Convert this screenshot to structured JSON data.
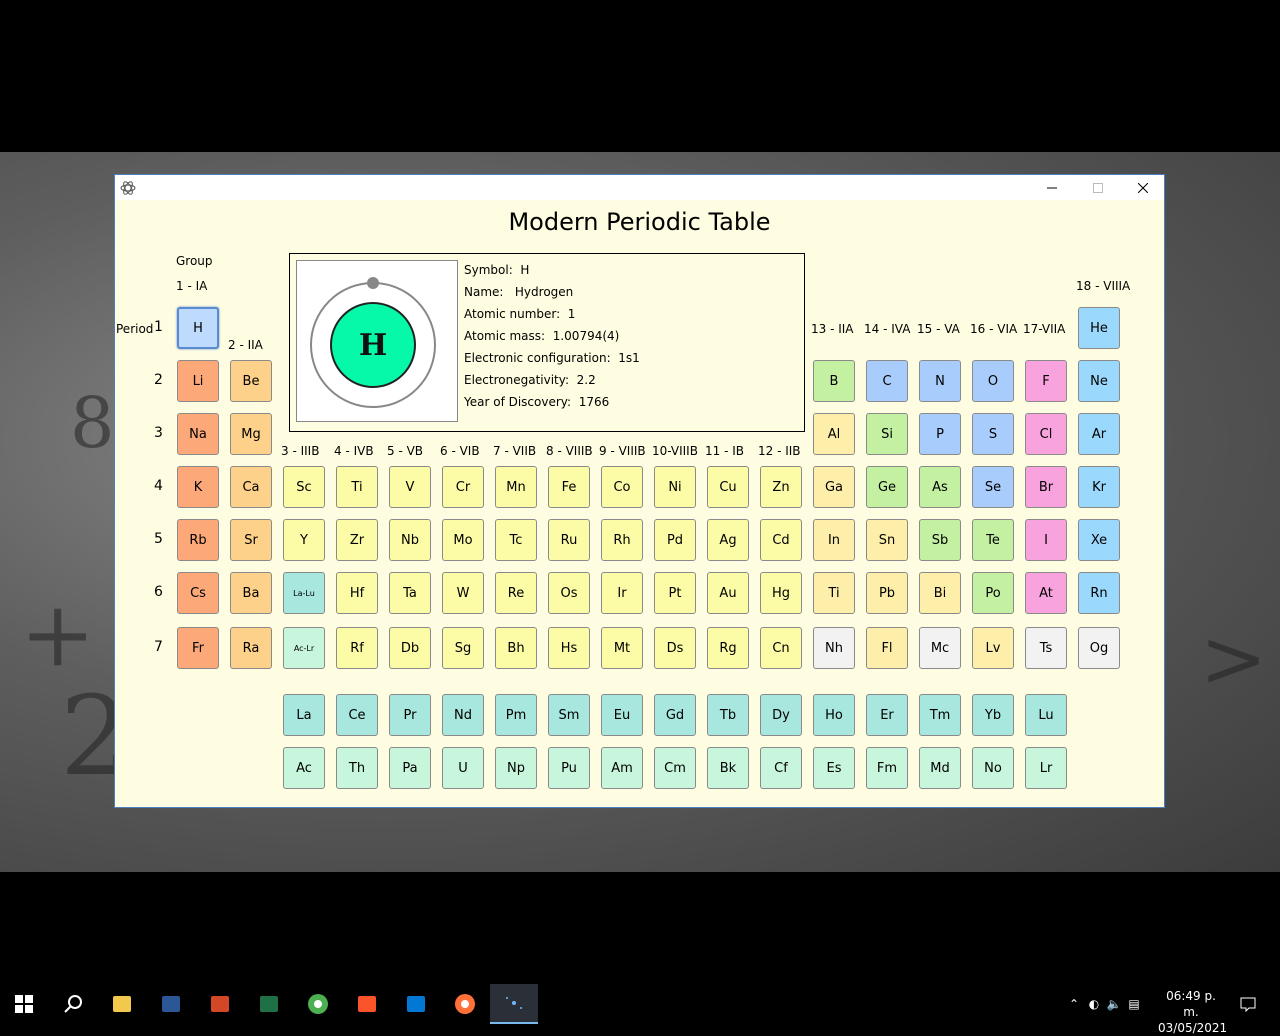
{
  "window": {
    "title": "Modern Periodic Table"
  },
  "labels": {
    "group": "Group",
    "period": "Period",
    "groups": [
      "1 - IA",
      "2 - IIA",
      "3 - IIIB",
      "4 - IVB",
      "5 - VB",
      "6 - VIB",
      "7 - VIIB",
      "8 - VIIIB",
      "9 - VIIIB",
      "10-VIIIB",
      "11 - IB",
      "12 - IIB",
      "13 - IIA",
      "14 - IVA",
      "15 - VA",
      "16 - VIA",
      "17-VIIA",
      "18 - VIIIA"
    ],
    "periods": [
      "1",
      "2",
      "3",
      "4",
      "5",
      "6",
      "7"
    ]
  },
  "selected": {
    "symbol_label": "Symbol:",
    "symbol": "H",
    "name_label": "Name:",
    "name": "Hydrogen",
    "atomic_number_label": "Atomic number:",
    "atomic_number": "1",
    "atomic_mass_label": "Atomic mass:",
    "atomic_mass": "1.00794(4)",
    "config_label": "Electronic configuration:",
    "config": "1s1",
    "electronegativity_label": "Electronegativity:",
    "electronegativity": "2.2",
    "discovery_label": "Year of Discovery:",
    "discovery": "1766",
    "diagram_symbol": "H"
  },
  "colors": {
    "alkali": "#fca878",
    "alkaline": "#fdd18a",
    "transition": "#fcfca6",
    "lanth_block": "#a7e7dd",
    "actin_block": "#c7f6dc",
    "post_transition": "#fdeea9",
    "metalloid": "#c4f0a2",
    "nonmetal": "#a8cdfc",
    "halogen": "#f8a3dd",
    "noble": "#9ad9fd",
    "unknown": "#f2f2f2",
    "hydrogen": "#bedbfd",
    "nucleus": "#06f9a9"
  },
  "elements": [
    {
      "s": "H",
      "c": "hydrogen",
      "g": 1,
      "p": 1
    },
    {
      "s": "He",
      "c": "noble",
      "g": 18,
      "p": 1
    },
    {
      "s": "Li",
      "c": "alkali",
      "g": 1,
      "p": 2
    },
    {
      "s": "Be",
      "c": "alkaline",
      "g": 2,
      "p": 2
    },
    {
      "s": "B",
      "c": "metalloid",
      "g": 13,
      "p": 2
    },
    {
      "s": "C",
      "c": "nonmetal",
      "g": 14,
      "p": 2
    },
    {
      "s": "N",
      "c": "nonmetal",
      "g": 15,
      "p": 2
    },
    {
      "s": "O",
      "c": "nonmetal",
      "g": 16,
      "p": 2
    },
    {
      "s": "F",
      "c": "halogen",
      "g": 17,
      "p": 2
    },
    {
      "s": "Ne",
      "c": "noble",
      "g": 18,
      "p": 2
    },
    {
      "s": "Na",
      "c": "alkali",
      "g": 1,
      "p": 3
    },
    {
      "s": "Mg",
      "c": "alkaline",
      "g": 2,
      "p": 3
    },
    {
      "s": "Al",
      "c": "post_transition",
      "g": 13,
      "p": 3
    },
    {
      "s": "Si",
      "c": "metalloid",
      "g": 14,
      "p": 3
    },
    {
      "s": "P",
      "c": "nonmetal",
      "g": 15,
      "p": 3
    },
    {
      "s": "S",
      "c": "nonmetal",
      "g": 16,
      "p": 3
    },
    {
      "s": "Cl",
      "c": "halogen",
      "g": 17,
      "p": 3
    },
    {
      "s": "Ar",
      "c": "noble",
      "g": 18,
      "p": 3
    },
    {
      "s": "K",
      "c": "alkali",
      "g": 1,
      "p": 4
    },
    {
      "s": "Ca",
      "c": "alkaline",
      "g": 2,
      "p": 4
    },
    {
      "s": "Sc",
      "c": "transition",
      "g": 3,
      "p": 4
    },
    {
      "s": "Ti",
      "c": "transition",
      "g": 4,
      "p": 4
    },
    {
      "s": "V",
      "c": "transition",
      "g": 5,
      "p": 4
    },
    {
      "s": "Cr",
      "c": "transition",
      "g": 6,
      "p": 4
    },
    {
      "s": "Mn",
      "c": "transition",
      "g": 7,
      "p": 4
    },
    {
      "s": "Fe",
      "c": "transition",
      "g": 8,
      "p": 4
    },
    {
      "s": "Co",
      "c": "transition",
      "g": 9,
      "p": 4
    },
    {
      "s": "Ni",
      "c": "transition",
      "g": 10,
      "p": 4
    },
    {
      "s": "Cu",
      "c": "transition",
      "g": 11,
      "p": 4
    },
    {
      "s": "Zn",
      "c": "transition",
      "g": 12,
      "p": 4
    },
    {
      "s": "Ga",
      "c": "post_transition",
      "g": 13,
      "p": 4
    },
    {
      "s": "Ge",
      "c": "metalloid",
      "g": 14,
      "p": 4
    },
    {
      "s": "As",
      "c": "metalloid",
      "g": 15,
      "p": 4
    },
    {
      "s": "Se",
      "c": "nonmetal",
      "g": 16,
      "p": 4
    },
    {
      "s": "Br",
      "c": "halogen",
      "g": 17,
      "p": 4
    },
    {
      "s": "Kr",
      "c": "noble",
      "g": 18,
      "p": 4
    },
    {
      "s": "Rb",
      "c": "alkali",
      "g": 1,
      "p": 5
    },
    {
      "s": "Sr",
      "c": "alkaline",
      "g": 2,
      "p": 5
    },
    {
      "s": "Y",
      "c": "transition",
      "g": 3,
      "p": 5
    },
    {
      "s": "Zr",
      "c": "transition",
      "g": 4,
      "p": 5
    },
    {
      "s": "Nb",
      "c": "transition",
      "g": 5,
      "p": 5
    },
    {
      "s": "Mo",
      "c": "transition",
      "g": 6,
      "p": 5
    },
    {
      "s": "Tc",
      "c": "transition",
      "g": 7,
      "p": 5
    },
    {
      "s": "Ru",
      "c": "transition",
      "g": 8,
      "p": 5
    },
    {
      "s": "Rh",
      "c": "transition",
      "g": 9,
      "p": 5
    },
    {
      "s": "Pd",
      "c": "transition",
      "g": 10,
      "p": 5
    },
    {
      "s": "Ag",
      "c": "transition",
      "g": 11,
      "p": 5
    },
    {
      "s": "Cd",
      "c": "transition",
      "g": 12,
      "p": 5
    },
    {
      "s": "In",
      "c": "post_transition",
      "g": 13,
      "p": 5
    },
    {
      "s": "Sn",
      "c": "post_transition",
      "g": 14,
      "p": 5
    },
    {
      "s": "Sb",
      "c": "metalloid",
      "g": 15,
      "p": 5
    },
    {
      "s": "Te",
      "c": "metalloid",
      "g": 16,
      "p": 5
    },
    {
      "s": "I",
      "c": "halogen",
      "g": 17,
      "p": 5
    },
    {
      "s": "Xe",
      "c": "noble",
      "g": 18,
      "p": 5
    },
    {
      "s": "Cs",
      "c": "alkali",
      "g": 1,
      "p": 6
    },
    {
      "s": "Ba",
      "c": "alkaline",
      "g": 2,
      "p": 6
    },
    {
      "s": "La-Lu",
      "c": "lanth_block",
      "g": 3,
      "p": 6,
      "small": true
    },
    {
      "s": "Hf",
      "c": "transition",
      "g": 4,
      "p": 6
    },
    {
      "s": "Ta",
      "c": "transition",
      "g": 5,
      "p": 6
    },
    {
      "s": "W",
      "c": "transition",
      "g": 6,
      "p": 6
    },
    {
      "s": "Re",
      "c": "transition",
      "g": 7,
      "p": 6
    },
    {
      "s": "Os",
      "c": "transition",
      "g": 8,
      "p": 6
    },
    {
      "s": "Ir",
      "c": "transition",
      "g": 9,
      "p": 6
    },
    {
      "s": "Pt",
      "c": "transition",
      "g": 10,
      "p": 6
    },
    {
      "s": "Au",
      "c": "transition",
      "g": 11,
      "p": 6
    },
    {
      "s": "Hg",
      "c": "transition",
      "g": 12,
      "p": 6
    },
    {
      "s": "Ti",
      "c": "post_transition",
      "g": 13,
      "p": 6
    },
    {
      "s": "Pb",
      "c": "post_transition",
      "g": 14,
      "p": 6
    },
    {
      "s": "Bi",
      "c": "post_transition",
      "g": 15,
      "p": 6
    },
    {
      "s": "Po",
      "c": "metalloid",
      "g": 16,
      "p": 6
    },
    {
      "s": "At",
      "c": "halogen",
      "g": 17,
      "p": 6
    },
    {
      "s": "Rn",
      "c": "noble",
      "g": 18,
      "p": 6
    },
    {
      "s": "Fr",
      "c": "alkali",
      "g": 1,
      "p": 7
    },
    {
      "s": "Ra",
      "c": "alkaline",
      "g": 2,
      "p": 7
    },
    {
      "s": "Ac-Lr",
      "c": "actin_block",
      "g": 3,
      "p": 7,
      "small": true
    },
    {
      "s": "Rf",
      "c": "transition",
      "g": 4,
      "p": 7
    },
    {
      "s": "Db",
      "c": "transition",
      "g": 5,
      "p": 7
    },
    {
      "s": "Sg",
      "c": "transition",
      "g": 6,
      "p": 7
    },
    {
      "s": "Bh",
      "c": "transition",
      "g": 7,
      "p": 7
    },
    {
      "s": "Hs",
      "c": "transition",
      "g": 8,
      "p": 7
    },
    {
      "s": "Mt",
      "c": "transition",
      "g": 9,
      "p": 7
    },
    {
      "s": "Ds",
      "c": "transition",
      "g": 10,
      "p": 7
    },
    {
      "s": "Rg",
      "c": "transition",
      "g": 11,
      "p": 7
    },
    {
      "s": "Cn",
      "c": "transition",
      "g": 12,
      "p": 7
    },
    {
      "s": "Nh",
      "c": "unknown",
      "g": 13,
      "p": 7
    },
    {
      "s": "Fl",
      "c": "post_transition",
      "g": 14,
      "p": 7
    },
    {
      "s": "Mc",
      "c": "unknown",
      "g": 15,
      "p": 7
    },
    {
      "s": "Lv",
      "c": "post_transition",
      "g": 16,
      "p": 7
    },
    {
      "s": "Ts",
      "c": "unknown",
      "g": 17,
      "p": 7
    },
    {
      "s": "Og",
      "c": "unknown",
      "g": 18,
      "p": 7
    }
  ],
  "lanthanides": [
    "La",
    "Ce",
    "Pr",
    "Nd",
    "Pm",
    "Sm",
    "Eu",
    "Gd",
    "Tb",
    "Dy",
    "Ho",
    "Er",
    "Tm",
    "Yb",
    "Lu"
  ],
  "actinides": [
    "Ac",
    "Th",
    "Pa",
    "U",
    "Np",
    "Pu",
    "Am",
    "Cm",
    "Bk",
    "Cf",
    "Es",
    "Fm",
    "Md",
    "No",
    "Lr"
  ],
  "taskbar": {
    "items": [
      "start-icon",
      "search-icon",
      "file-explorer-icon",
      "word-icon",
      "powerpoint-icon",
      "excel-icon",
      "chrome-icon",
      "brave-icon",
      "vscode-icon",
      "firefox-icon",
      "periodic-table-app-icon"
    ],
    "time": "06:49 p. m.",
    "date": "03/05/2021"
  }
}
